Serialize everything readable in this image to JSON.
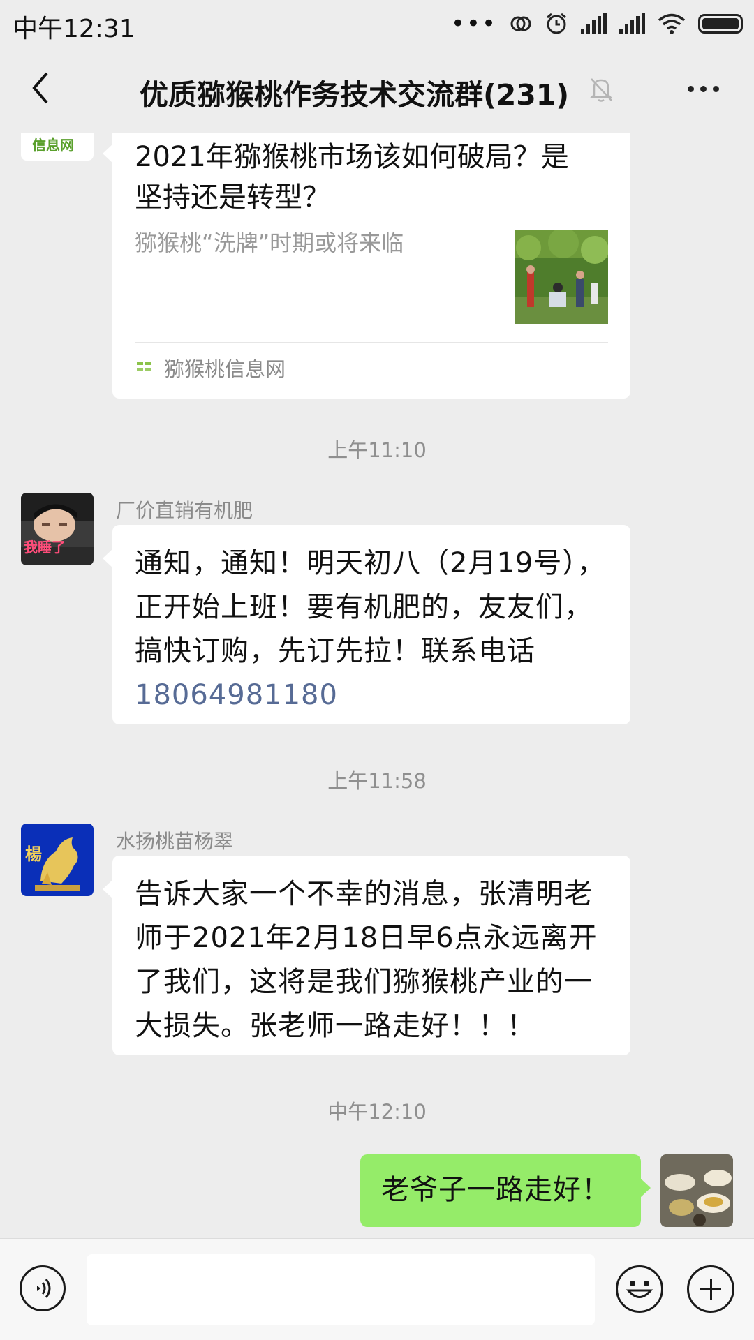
{
  "status_bar": {
    "time": "中午12:31",
    "icons": [
      "more-dots-icon",
      "link-icon",
      "alarm-icon",
      "signal-icon",
      "signal-icon",
      "wifi-icon",
      "battery-icon"
    ]
  },
  "header": {
    "title": "优质猕猴桃作务技术交流群(231)",
    "back_icon": "chevron-left-icon",
    "mute_icon": "bell-muted-icon",
    "more_icon": "more-dots-icon"
  },
  "messages": {
    "link_card": {
      "avatar_text": "信息网",
      "title": "2021年猕猴桃市场该如何破局？是坚持还是转型？",
      "description": "猕猴桃“洗牌”时期或将来临",
      "source": "猕猴桃信息网"
    },
    "time_1": "上午11:10",
    "msg_1": {
      "sender": "厂价直销有机肥",
      "avatar_caption": "我睡了",
      "text": "通知，通知！明天初八（2月19号），正开始上班！要有机肥的，友友们，搞快订购，先订先拉！联系电话",
      "phone": "18064981180"
    },
    "time_2": "上午11:58",
    "msg_2": {
      "sender": "水扬桃苗杨翠",
      "avatar_caption": "楊",
      "text": "告诉大家一个不幸的消息，张清明老师于2021年2月18日早6点永远离开了我们，这将是我们猕猴桃产业的一大损失。张老师一路走好！！！"
    },
    "time_3": "中午12:10",
    "msg_3": {
      "text": "老爷子一路走好！"
    }
  },
  "input_bar": {
    "voice_icon": "voice-icon",
    "emoji_icon": "emoji-icon",
    "plus_icon": "plus-icon",
    "input_value": ""
  },
  "colors": {
    "background": "#ededed",
    "bubble_self": "#95ec69",
    "bubble_other": "#ffffff",
    "link": "#576b95"
  }
}
